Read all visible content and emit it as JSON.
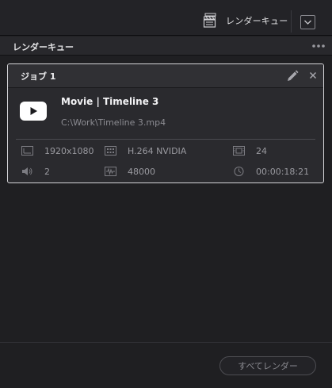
{
  "topbar": {
    "render_queue_label": "レンダーキュー",
    "render_queue_icon": "clapperboard-stack-icon",
    "dropdown_icon": "chevron-down-icon"
  },
  "panel": {
    "title": "レンダーキュー",
    "more_icon": "more-dots-icon"
  },
  "job": {
    "title": "ジョブ 1",
    "name": "Movie | Timeline 3",
    "path": "C:\\Work\\Timeline 3.mp4",
    "stats": {
      "resolution": "1920x1080",
      "codec": "H.264 NVIDIA",
      "frame_rate": "24",
      "audio_channels": "2",
      "sample_rate": "48000",
      "duration": "00:00:18:21"
    }
  },
  "footer": {
    "render_all_label": "すべてレンダー"
  },
  "colors": {
    "background": "#1f1f22",
    "card": "#2a2a2e",
    "card_border": "#d4d4d8",
    "text_primary": "#f2f2f4",
    "text_muted": "#8c8c92"
  }
}
